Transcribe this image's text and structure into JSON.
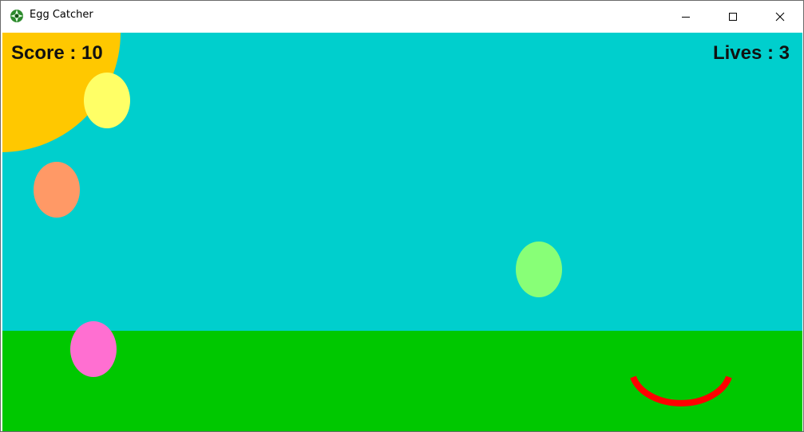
{
  "window": {
    "title": "Egg Catcher",
    "icons": {
      "app": "egg-catcher-app-icon",
      "minimize": "minimize-icon",
      "maximize": "maximize-icon",
      "close": "close-icon"
    }
  },
  "hud": {
    "score_text": "Score : 10",
    "lives_text": "Lives : 3",
    "score": 10,
    "lives": 3
  },
  "colors": {
    "sky": "#00cfcd",
    "grass": "#00c800",
    "sun": "#ffc800",
    "catcher": "#ff0000",
    "eggs": [
      "#ffff66",
      "#ff9966",
      "#88ff77",
      "#ff6fd1"
    ]
  }
}
